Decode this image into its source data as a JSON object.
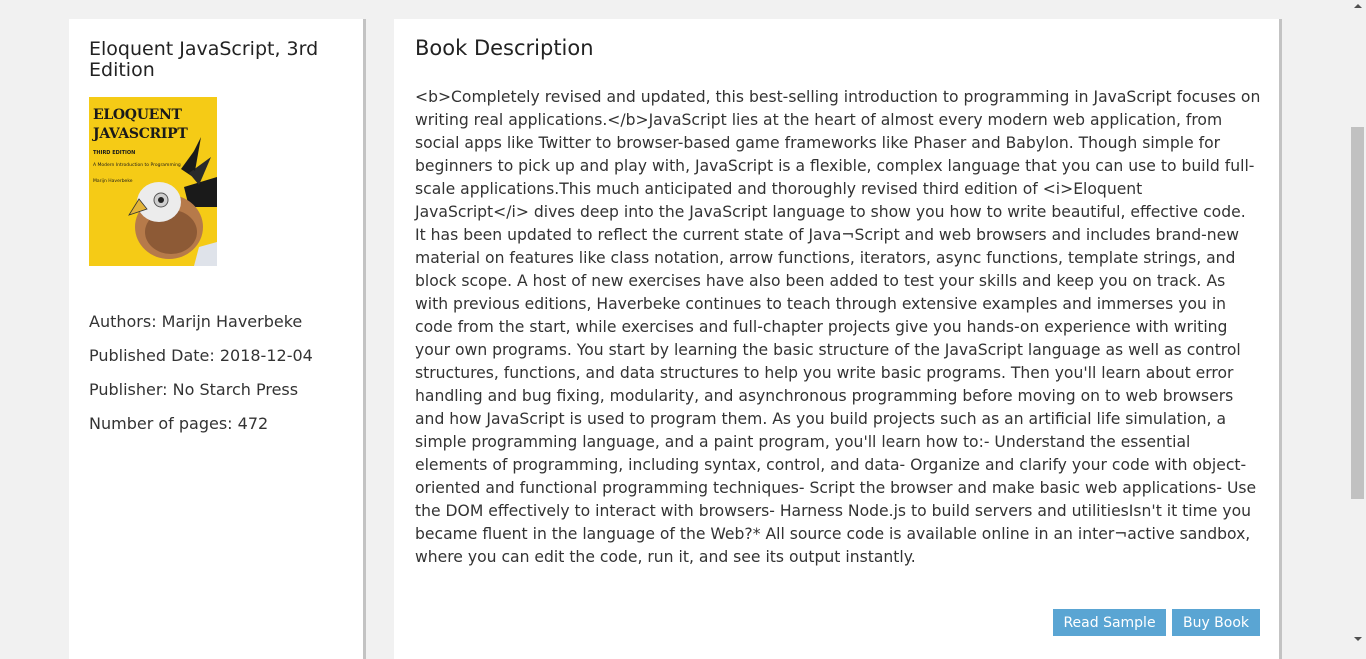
{
  "book": {
    "title": "Eloquent JavaScript, 3rd Edition",
    "cover": {
      "title_line1": "ELOQUENT",
      "title_line2": "JAVASCRIPT",
      "edition": "THIRD EDITION",
      "subtitle": "A Modern Introduction to Programming",
      "author": "Marijn Haverbeke",
      "background_color": "#f5cb16"
    },
    "authors": "Authors: Marijn Haverbeke",
    "published_date": "Published Date: 2018-12-04",
    "publisher": "Publisher: No Starch Press",
    "pages": "Number of pages: 472"
  },
  "description": {
    "heading": "Book Description",
    "text": "<b>Completely revised and updated, this best-selling introduction to programming in JavaScript focuses on writing real applications.</b>JavaScript lies at the heart of almost every modern web application, from social apps like Twitter to browser-based game frameworks like Phaser and Babylon. Though simple for beginners to pick up and play with, JavaScript is a flexible, complex language that you can use to build full-scale applications.This much anticipated and thoroughly revised third edition of <i>Eloquent JavaScript</i> dives deep into the JavaScript language to show you how to write beautiful, effective code. It has been updated to reflect the current state of Java¬Script and web browsers and includes brand-new material on features like class notation, arrow functions, iterators, async functions, template strings, and block scope. A host of new exercises have also been added to test your skills and keep you on track. As with previous editions, Haverbeke continues to teach through extensive examples and immerses you in code from the start, while exercises and full-chapter projects give you hands-on experience with writing your own programs. You start by learning the basic structure of the JavaScript language as well as control structures, functions, and data structures to help you write basic programs. Then you'll learn about error handling and bug fixing, modularity, and asynchronous programming before moving on to web browsers and how JavaScript is used to program them. As you build projects such as an artificial life simulation, a simple programming language, and a paint program, you'll learn how to:- Understand the essential elements of programming, including syntax, control, and data- Organize and clarify your code with object-oriented and functional programming techniques- Script the browser and make basic web applications- Use the DOM effectively to interact with browsers- Harness Node.js to build servers and utilitiesIsn't it time you became fluent in the language of the Web?* All source code is available online in an inter¬active sandbox, where you can edit the code, run it, and see its output instantly."
  },
  "actions": {
    "read_sample": "Read Sample",
    "buy_book": "Buy Book",
    "button_color": "#5aa5d3"
  }
}
